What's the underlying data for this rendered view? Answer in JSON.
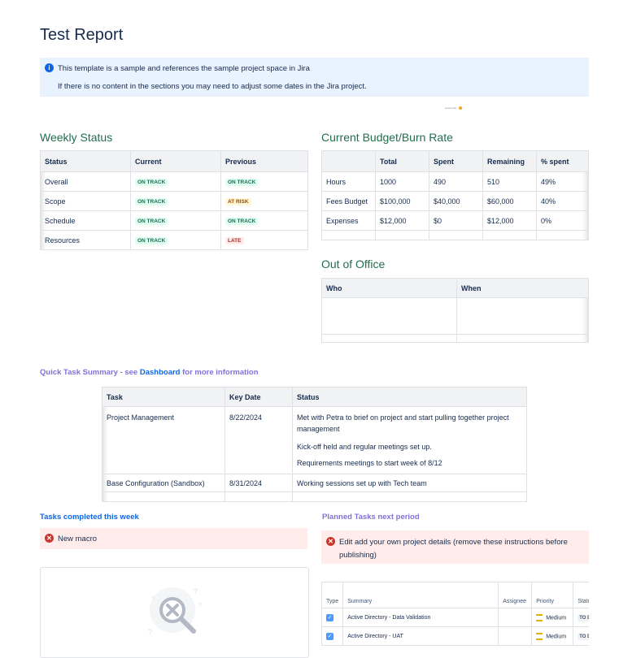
{
  "page": {
    "title": "Test Report"
  },
  "info_panel": {
    "line1": "This template is a sample and references the sample project space in Jira",
    "line2": "If there is no content in the sections you may need to adjust some dates in the Jira project."
  },
  "powered_by": "poweredby",
  "weekly_status": {
    "heading": "Weekly Status",
    "headers": [
      "Status",
      "Current",
      "Previous"
    ],
    "rows": [
      {
        "label": "Overall",
        "current": "ON TRACK",
        "previous": "ON TRACK"
      },
      {
        "label": "Scope",
        "current": "ON TRACK",
        "previous": "AT RISK"
      },
      {
        "label": "Schedule",
        "current": "ON TRACK",
        "previous": "ON TRACK"
      },
      {
        "label": "Resources",
        "current": "ON TRACK",
        "previous": "LATE"
      }
    ]
  },
  "budget": {
    "heading": "Current Budget/Burn Rate",
    "headers": [
      "",
      "Total",
      "Spent",
      "Remaining",
      "% spent"
    ],
    "rows": [
      [
        "Hours",
        "1000",
        "490",
        "510",
        "49%"
      ],
      [
        "Fees Budget",
        "$100,000",
        "$40,000",
        "$60,000",
        "40%"
      ],
      [
        "Expenses",
        "$12,000",
        "$0",
        "$12,000",
        "0%"
      ]
    ]
  },
  "out_of_office": {
    "heading": "Out of Office",
    "headers": [
      "Who",
      "When"
    ]
  },
  "quick_summary": {
    "prefix": "Quick Task Summary - see ",
    "link": "Dashboard",
    "suffix": " for more information",
    "headers": [
      "Task",
      "Key Date",
      "Status"
    ],
    "rows": [
      {
        "task": "Project Management",
        "date": "8/22/2024",
        "status": [
          "Met with Petra to brief on project and start pulling together project management",
          "Kick-off held and regular meetings set up.",
          "Requirements meetings to start week of 8/12"
        ]
      },
      {
        "task": "Base Configuration (Sandbox)",
        "date": "8/31/2024",
        "status": [
          "Working sessions set up with Tech team"
        ]
      }
    ]
  },
  "tasks_completed": {
    "heading": "Tasks completed this week",
    "error": "New macro"
  },
  "planned_tasks": {
    "heading": "Planned Tasks next period",
    "error": "Edit add your own project details (remove these instructions before publishing)",
    "headers": [
      "Type",
      "Summary",
      "Assignee",
      "Priority",
      "Status"
    ],
    "rows": [
      {
        "summary": "Active Directory - Data Validation",
        "priority": "Medium",
        "status": "TO DO"
      },
      {
        "summary": "Active Directory - UAT",
        "priority": "Medium",
        "status": "TO DO"
      }
    ]
  },
  "colors": {
    "heading_green": "#216e4e",
    "heading_purple": "#8270db",
    "link_blue": "#0c66e4",
    "info_bg": "#e9f2ff",
    "error_bg": "#ffeceb"
  }
}
